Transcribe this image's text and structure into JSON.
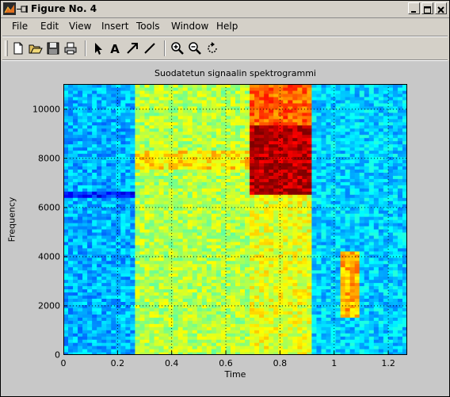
{
  "window": {
    "title": "Figure No. 4"
  },
  "menu": {
    "items": [
      "File",
      "Edit",
      "View",
      "Insert",
      "Tools",
      "Window",
      "Help"
    ]
  },
  "toolbar": {
    "tools": [
      "new-file",
      "open-file",
      "save",
      "print",
      "select-arrow",
      "insert-text",
      "insert-arrow",
      "insert-line",
      "zoom-in",
      "zoom-out",
      "rotate-3d"
    ]
  },
  "chart_data": {
    "type": "heatmap",
    "title": "Suodatetun signaalin spektrogrammi",
    "xlabel": "Time",
    "ylabel": "Frequency",
    "xlim": [
      0,
      1.27
    ],
    "ylim": [
      0,
      11025
    ],
    "xticks": [
      "0",
      "0.2",
      "0.4",
      "0.6",
      "0.8",
      "1",
      "1.2"
    ],
    "yticks": [
      "0",
      "2000",
      "4000",
      "6000",
      "8000",
      "10000"
    ],
    "grid": true,
    "colormap": "jet",
    "regions": [
      {
        "x": [
          0,
          0.27
        ],
        "y": [
          0,
          11025
        ],
        "level": 0.3,
        "description": "low energy"
      },
      {
        "x": [
          0,
          0.27
        ],
        "y": [
          6450,
          6650
        ],
        "level": 0.15
      },
      {
        "x": [
          0.27,
          0.68
        ],
        "y": [
          0,
          11025
        ],
        "level": 0.55
      },
      {
        "x": [
          0.27,
          0.68
        ],
        "y": [
          7500,
          8300
        ],
        "level": 0.65
      },
      {
        "x": [
          0.68,
          0.92
        ],
        "y": [
          6600,
          9400
        ],
        "level": 0.95
      },
      {
        "x": [
          0.68,
          0.92
        ],
        "y": [
          9400,
          11025
        ],
        "level": 0.78
      },
      {
        "x": [
          0.68,
          0.92
        ],
        "y": [
          0,
          6600
        ],
        "level": 0.6
      },
      {
        "x": [
          0.92,
          1.27
        ],
        "y": [
          0,
          11025
        ],
        "level": 0.33
      },
      {
        "x": [
          1.03,
          1.1
        ],
        "y": [
          1500,
          4200
        ],
        "level": 0.7
      }
    ]
  },
  "colors": {
    "window_bg": "#d4d0c8",
    "figure_bg": "#c8c8c8"
  }
}
